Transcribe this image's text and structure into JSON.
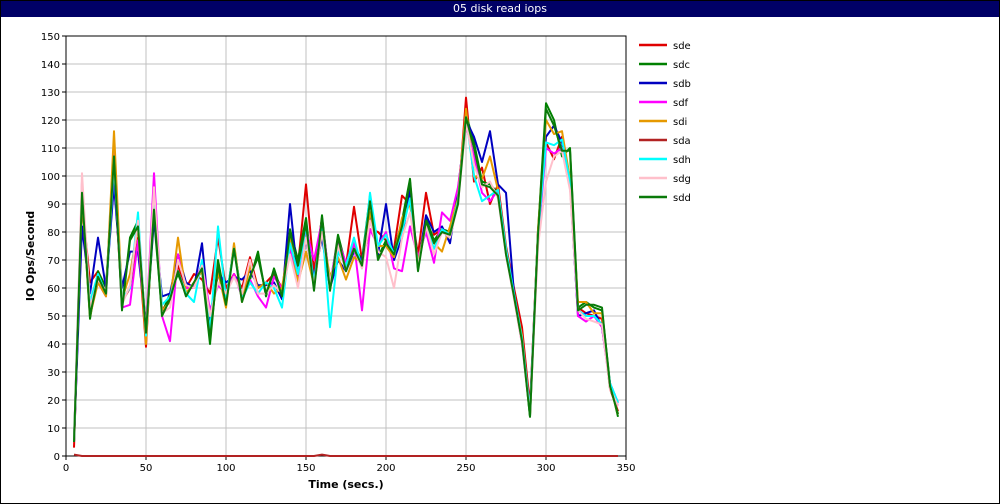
{
  "window": {
    "title": "05 disk read iops"
  },
  "colors": {
    "titlebar": "#000066",
    "grid": "#c0c0c0"
  },
  "chart_data": {
    "type": "line",
    "title": "05 disk read iops",
    "xlabel": "Time (secs.)",
    "ylabel": "IO Ops/Second",
    "xlim": [
      0,
      350
    ],
    "ylim": [
      0,
      150
    ],
    "x_ticks": [
      0,
      50,
      100,
      150,
      200,
      250,
      300,
      350
    ],
    "y_ticks": [
      0,
      10,
      20,
      30,
      40,
      50,
      60,
      70,
      80,
      90,
      100,
      110,
      120,
      130,
      140,
      150
    ],
    "grid": true,
    "legend_position": "right",
    "x": [
      5,
      10,
      15,
      20,
      25,
      30,
      35,
      40,
      45,
      50,
      55,
      60,
      65,
      70,
      75,
      80,
      85,
      90,
      95,
      100,
      105,
      110,
      115,
      120,
      125,
      130,
      135,
      140,
      145,
      150,
      155,
      160,
      165,
      170,
      175,
      180,
      185,
      190,
      195,
      200,
      205,
      210,
      215,
      220,
      225,
      230,
      235,
      240,
      245,
      250,
      255,
      260,
      265,
      270,
      275,
      280,
      285,
      290,
      295,
      300,
      305,
      310,
      315,
      320,
      325,
      330,
      335,
      340,
      345
    ],
    "series": [
      {
        "name": "sde",
        "color": "#e00000",
        "values": [
          3,
          91,
          62,
          66,
          60,
          101,
          55,
          60,
          78,
          39,
          93,
          52,
          56,
          68,
          60,
          65,
          63,
          58,
          78,
          60,
          65,
          60,
          71,
          60,
          62,
          65,
          60,
          74,
          68,
          97,
          66,
          85,
          60,
          75,
          68,
          89,
          70,
          81,
          80,
          77,
          74,
          93,
          90,
          72,
          94,
          79,
          81,
          80,
          90,
          128,
          98,
          103,
          90,
          97,
          75,
          60,
          46,
          18,
          80,
          112,
          106,
          114,
          99,
          53,
          51,
          50,
          49,
          24,
          16
        ]
      },
      {
        "name": "sdc",
        "color": "#008000",
        "values": [
          5,
          93,
          49,
          66,
          60,
          108,
          53,
          78,
          84,
          44,
          85,
          51,
          58,
          65,
          58,
          62,
          66,
          40,
          70,
          55,
          75,
          56,
          63,
          73,
          57,
          67,
          58,
          81,
          70,
          85,
          60,
          86,
          60,
          79,
          68,
          75,
          70,
          93,
          71,
          77,
          73,
          84,
          99,
          67,
          85,
          77,
          81,
          80,
          91,
          122,
          112,
          98,
          97,
          94,
          73,
          58,
          42,
          14,
          80,
          126,
          120,
          107,
          110,
          53,
          55,
          53,
          52,
          26,
          14
        ]
      },
      {
        "name": "sdb",
        "color": "#0000c0",
        "values": [
          5,
          82,
          58,
          78,
          60,
          97,
          60,
          73,
          73,
          47,
          85,
          57,
          58,
          72,
          62,
          60,
          76,
          47,
          65,
          62,
          64,
          63,
          66,
          61,
          61,
          62,
          56,
          90,
          63,
          77,
          64,
          78,
          60,
          70,
          66,
          73,
          70,
          87,
          72,
          90,
          70,
          78,
          95,
          68,
          86,
          80,
          82,
          76,
          95,
          120,
          114,
          105,
          116,
          97,
          94,
          58,
          42,
          16,
          80,
          114,
          118,
          112,
          97,
          50,
          51,
          52,
          46,
          26,
          19
        ]
      },
      {
        "name": "sdf",
        "color": "#ff00ff",
        "values": [
          5,
          98,
          53,
          62,
          57,
          108,
          53,
          54,
          77,
          45,
          101,
          50,
          41,
          72,
          60,
          60,
          69,
          52,
          61,
          58,
          65,
          57,
          63,
          57,
          53,
          64,
          60,
          74,
          62,
          81,
          70,
          84,
          62,
          77,
          69,
          76,
          52,
          81,
          75,
          80,
          67,
          66,
          82,
          71,
          80,
          69,
          87,
          84,
          96,
          118,
          107,
          94,
          91,
          95,
          72,
          57,
          40,
          16,
          77,
          110,
          108,
          110,
          98,
          50,
          48,
          50,
          46,
          25,
          18
        ]
      },
      {
        "name": "sdi",
        "color": "#e69900",
        "values": [
          5,
          93,
          50,
          62,
          57,
          116,
          56,
          65,
          82,
          40,
          93,
          52,
          55,
          78,
          58,
          62,
          66,
          45,
          66,
          53,
          76,
          55,
          68,
          60,
          62,
          58,
          60,
          78,
          62,
          73,
          61,
          80,
          64,
          71,
          63,
          71,
          69,
          87,
          75,
          75,
          71,
          85,
          90,
          69,
          83,
          76,
          73,
          82,
          92,
          124,
          100,
          99,
          107,
          95,
          73,
          57,
          43,
          15,
          81,
          120,
          115,
          116,
          99,
          55,
          55,
          51,
          51,
          25,
          15
        ]
      },
      {
        "name": "sda",
        "color": "#b22222",
        "values": [
          0.5,
          0,
          0,
          0,
          0,
          0,
          0,
          0,
          0,
          0,
          0,
          0,
          0,
          0,
          0,
          0,
          0,
          0,
          0,
          0,
          0,
          0,
          0,
          0,
          0,
          0,
          0,
          0,
          0,
          0,
          0,
          0.5,
          0,
          0,
          0,
          0,
          0,
          0,
          0,
          0,
          0,
          0,
          0,
          0,
          0,
          0,
          0,
          0,
          0,
          0,
          0,
          0,
          0,
          0,
          0,
          0,
          0,
          0,
          0,
          0,
          0,
          0,
          0,
          0,
          0,
          0,
          0,
          0,
          0
        ]
      },
      {
        "name": "sdh",
        "color": "#00ffff",
        "values": [
          5,
          96,
          55,
          65,
          58,
          104,
          56,
          60,
          87,
          43,
          90,
          54,
          57,
          66,
          58,
          55,
          70,
          44,
          82,
          56,
          74,
          56,
          62,
          58,
          62,
          60,
          53,
          76,
          65,
          82,
          62,
          83,
          46,
          73,
          68,
          78,
          67,
          94,
          75,
          79,
          72,
          80,
          92,
          68,
          82,
          74,
          81,
          79,
          91,
          121,
          100,
          91,
          93,
          95,
          74,
          58,
          42,
          16,
          79,
          112,
          111,
          113,
          98,
          52,
          50,
          50,
          47,
          26,
          19
        ]
      },
      {
        "name": "sdg",
        "color": "#ffc0cb",
        "values": [
          5,
          101,
          53,
          63,
          59,
          106,
          54,
          61,
          84,
          44,
          96,
          51,
          53,
          70,
          61,
          60,
          68,
          50,
          62,
          58,
          64,
          58,
          70,
          58,
          58,
          61,
          58,
          72,
          60,
          78,
          61,
          80,
          62,
          75,
          66,
          74,
          67,
          84,
          73,
          71,
          60,
          78,
          87,
          68,
          82,
          72,
          80,
          78,
          90,
          119,
          104,
          96,
          98,
          92,
          72,
          56,
          40,
          15,
          75,
          98,
          107,
          109,
          95,
          52,
          49,
          48,
          47,
          24,
          18
        ]
      },
      {
        "name": "sdd",
        "color": "#0a7a0a",
        "values": [
          5,
          94,
          50,
          64,
          58,
          107,
          52,
          77,
          82,
          44,
          88,
          50,
          56,
          66,
          57,
          62,
          67,
          42,
          68,
          54,
          74,
          55,
          64,
          71,
          58,
          66,
          57,
          80,
          68,
          83,
          59,
          85,
          59,
          78,
          66,
          74,
          68,
          91,
          70,
          76,
          72,
          82,
          98,
          66,
          84,
          76,
          80,
          79,
          90,
          121,
          110,
          97,
          96,
          93,
          72,
          57,
          41,
          14,
          79,
          124,
          118,
          109,
          109,
          52,
          54,
          54,
          53,
          25,
          15
        ]
      }
    ]
  }
}
